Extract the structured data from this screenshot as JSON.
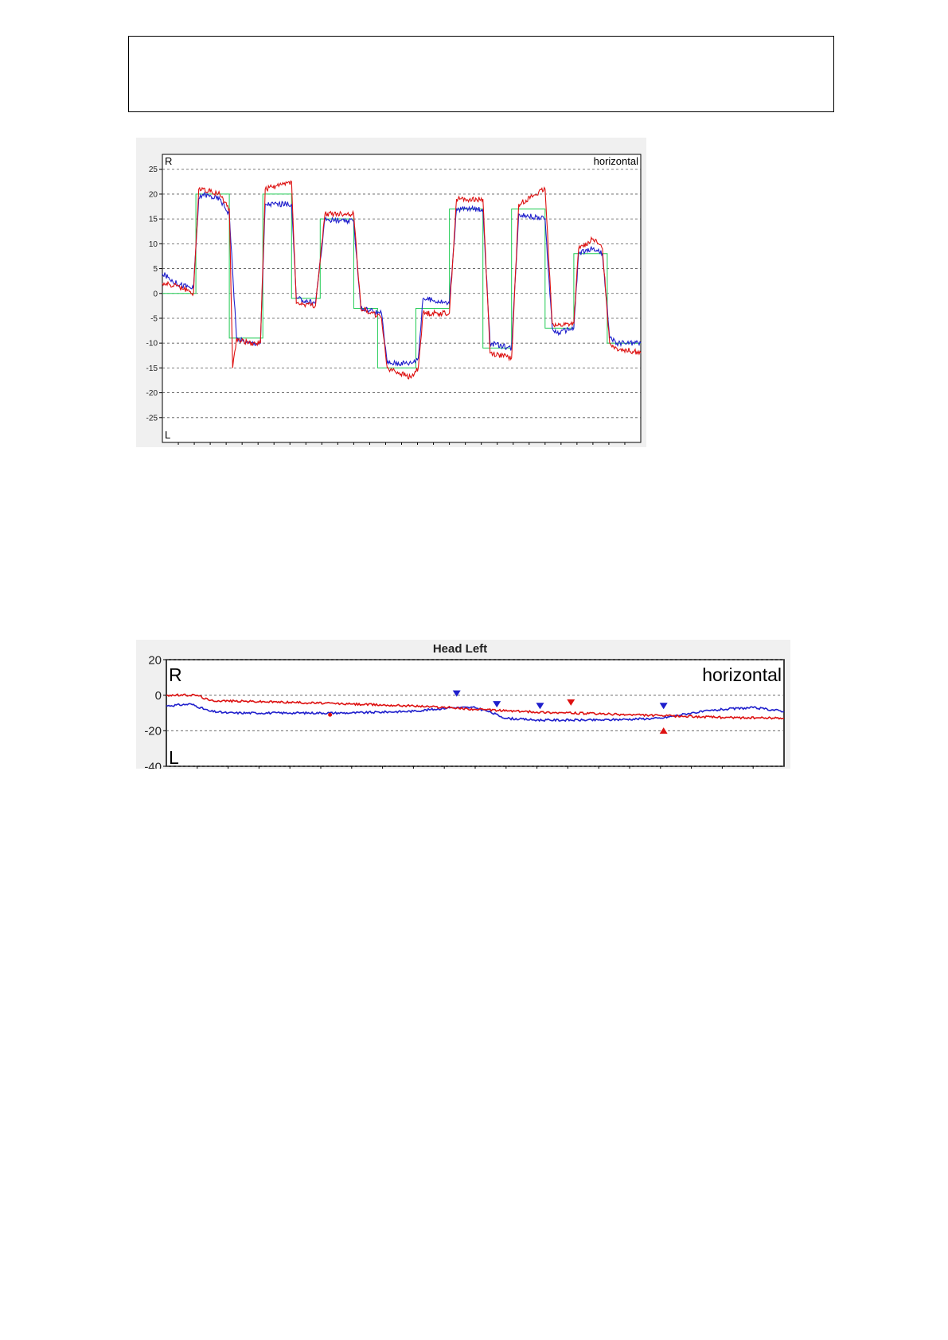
{
  "page": {
    "header_box_text": ""
  },
  "chart_data": [
    {
      "type": "line",
      "title": "",
      "corner_label": "horizontal",
      "top_label": "R",
      "bottom_label": "L",
      "ylim": [
        -30,
        28
      ],
      "yticks": [
        25,
        20,
        15,
        10,
        5,
        0,
        -5,
        -10,
        -15,
        -20,
        -25
      ],
      "xlim": [
        0,
        100
      ],
      "grid": true,
      "colors": {
        "stimulus": "#22cc55",
        "series_a": "#1f1fcc",
        "series_b": "#dd1111"
      },
      "series": [
        {
          "key": "stimulus",
          "x": [
            0,
            7,
            7,
            14,
            14,
            21,
            21,
            27,
            27,
            33,
            33,
            40,
            40,
            45,
            45,
            53,
            53,
            60,
            60,
            67,
            67,
            73,
            73,
            80,
            80,
            86,
            86,
            93,
            93,
            100
          ],
          "values": [
            0,
            0,
            20,
            20,
            -9,
            -9,
            20,
            20,
            -1,
            -1,
            15,
            15,
            -3,
            -3,
            -15,
            -15,
            -3,
            -3,
            17,
            17,
            -11,
            -11,
            17,
            17,
            -7,
            -7,
            8,
            8,
            -10,
            -10
          ]
        },
        {
          "key": "series_a",
          "x": [
            0,
            3,
            6.5,
            7.6,
            8.5,
            12,
            14,
            15.5,
            18,
            20.5,
            21.5,
            27,
            28,
            32,
            34,
            38,
            40,
            41.5,
            44,
            45.8,
            47,
            52,
            53.5,
            54.5,
            60,
            61.5,
            67,
            68.5,
            73,
            74.5,
            80,
            81.5,
            82.5,
            86,
            87,
            90,
            92,
            93.5,
            95,
            100
          ],
          "values": [
            4,
            2,
            1,
            19,
            20,
            19,
            16,
            -9,
            -10,
            -10,
            18,
            18,
            -1,
            -2,
            15,
            14.5,
            14.5,
            -3,
            -3.5,
            -4,
            -14,
            -14,
            -13,
            -1,
            -2,
            17,
            17,
            -10,
            -11,
            16,
            15,
            -7,
            -8,
            -7,
            8,
            9,
            8,
            -9,
            -10,
            -10
          ]
        },
        {
          "key": "series_b",
          "x": [
            0,
            3,
            6.5,
            7.6,
            8.5,
            12,
            14,
            14.7,
            15.5,
            18,
            20.5,
            21.5,
            27,
            28,
            32,
            34,
            38,
            40,
            41.5,
            44,
            45.8,
            47,
            52,
            53.5,
            54.5,
            60,
            61.5,
            67,
            68.5,
            73,
            74.5,
            80,
            81.5,
            82.5,
            86,
            87,
            90,
            92,
            93.5,
            95,
            100
          ],
          "values": [
            2,
            1.5,
            0,
            21,
            21,
            20,
            17,
            -15,
            -9,
            -10,
            -10,
            21,
            22.5,
            -2,
            -2.5,
            16,
            16,
            16,
            -3,
            -4,
            -5,
            -15,
            -17,
            -15,
            -4,
            -4,
            19,
            19,
            -12,
            -13,
            18,
            21,
            -6,
            -6.5,
            -6,
            9,
            11,
            9,
            -10,
            -11,
            -12
          ]
        }
      ]
    },
    {
      "type": "line",
      "title": "Head Left",
      "corner_label": "horizontal",
      "top_label": "R",
      "bottom_label": "L",
      "ylim": [
        -40,
        20
      ],
      "yticks": [
        20,
        0,
        -20,
        -40
      ],
      "xlim": [
        0,
        100
      ],
      "grid": true,
      "colors": {
        "series_a": "#1f1fcc",
        "series_b": "#dd1111"
      },
      "series": [
        {
          "key": "series_a",
          "x": [
            0,
            4,
            7,
            10,
            20,
            30,
            40,
            46,
            50,
            52,
            55,
            60,
            70,
            80,
            85,
            90,
            95,
            100
          ],
          "values": [
            -6,
            -5,
            -9,
            -10,
            -10,
            -10,
            -9,
            -7,
            -7,
            -9,
            -13,
            -14,
            -14,
            -13,
            -10,
            -8,
            -7,
            -9
          ]
        },
        {
          "key": "series_b",
          "x": [
            0,
            5,
            7,
            20,
            30,
            40,
            46,
            50,
            60,
            70,
            80,
            90,
            100
          ],
          "values": [
            0,
            0,
            -3,
            -4,
            -5,
            -6,
            -7,
            -8,
            -9.5,
            -10.5,
            -11.5,
            -12.5,
            -13
          ]
        }
      ],
      "markers": [
        {
          "x": 47,
          "y": 0,
          "color": "#1f1fcc",
          "dir": "down"
        },
        {
          "x": 53.5,
          "y": -6,
          "color": "#1f1fcc",
          "dir": "down"
        },
        {
          "x": 60.5,
          "y": -7,
          "color": "#1f1fcc",
          "dir": "down"
        },
        {
          "x": 65.5,
          "y": -5,
          "color": "#dd1111",
          "dir": "down"
        },
        {
          "x": 80.5,
          "y": -7,
          "color": "#1f1fcc",
          "dir": "down"
        },
        {
          "x": 80.5,
          "y": -19,
          "color": "#dd1111",
          "dir": "up"
        },
        {
          "x": 26.5,
          "y": -11,
          "color": "#dd1111",
          "dir": "dot"
        }
      ]
    }
  ]
}
